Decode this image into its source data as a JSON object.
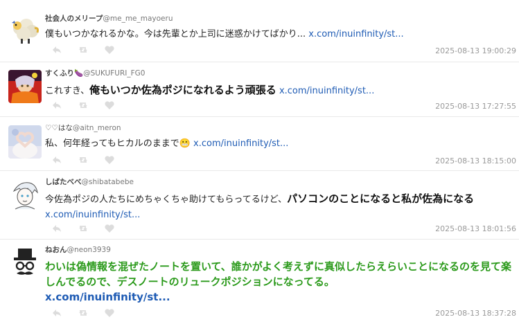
{
  "tweets": [
    {
      "display_name": "社会人のメリープ",
      "handle": "@me_me_mayoeru",
      "text": "僕もいつかなれるかな。今は先輩とか上司に迷惑かけてばかり... ",
      "link": "x.com/inuinfinity/st...",
      "timestamp": "2025-08-13 19:00:29",
      "avatar_icon": "sheep-avatar"
    },
    {
      "display_name": "すくふり🍆",
      "handle": "@SUKUFURI_FG0",
      "text_normal": "これすき、",
      "text_big": "俺もいつか佐為ポジになれるよう頑張る",
      "link": "x.com/inuinfinity/st...",
      "timestamp": "2025-08-13 17:27:55",
      "avatar_icon": "anime-character-avatar"
    },
    {
      "display_name": "♡♡はな",
      "handle": "@aitn_meron",
      "text": "私、何年経ってもヒカルのままで😬 ",
      "link": "x.com/inuinfinity/st...",
      "timestamp": "2025-08-13 18:15:00",
      "avatar_icon": "heart-hands-avatar"
    },
    {
      "display_name": "しばたべべ",
      "handle": "@shibatabebe",
      "text_normal": "今佐為ポジの人たちにめちゃくちゃ助けてもらってるけど、",
      "text_big": "パソコンのことになると私が佐為になる",
      "link": "x.com/inuinfinity/st...",
      "timestamp": "2025-08-13 18:01:56",
      "avatar_icon": "sketch-character-avatar"
    },
    {
      "display_name": "ねおん",
      "handle": "@neon3939",
      "text": "わいは偽情報を混ぜたノートを置いて、誰かがよく考えずに真似したらえらいことになるのを見て楽しんでるので、デスノートのリュークポジションになってる。",
      "link": "x.com/inuinfinity/st...",
      "timestamp": "2025-08-13 18:37:28",
      "avatar_icon": "top-hat-mustache-avatar"
    }
  ],
  "actions": {
    "reply_icon": "reply-icon",
    "retweet_icon": "retweet-icon",
    "like_icon": "heart-icon"
  },
  "colors": {
    "link": "#1e5bb4",
    "green_text": "#2b9a1b",
    "timestamp": "#999999"
  }
}
